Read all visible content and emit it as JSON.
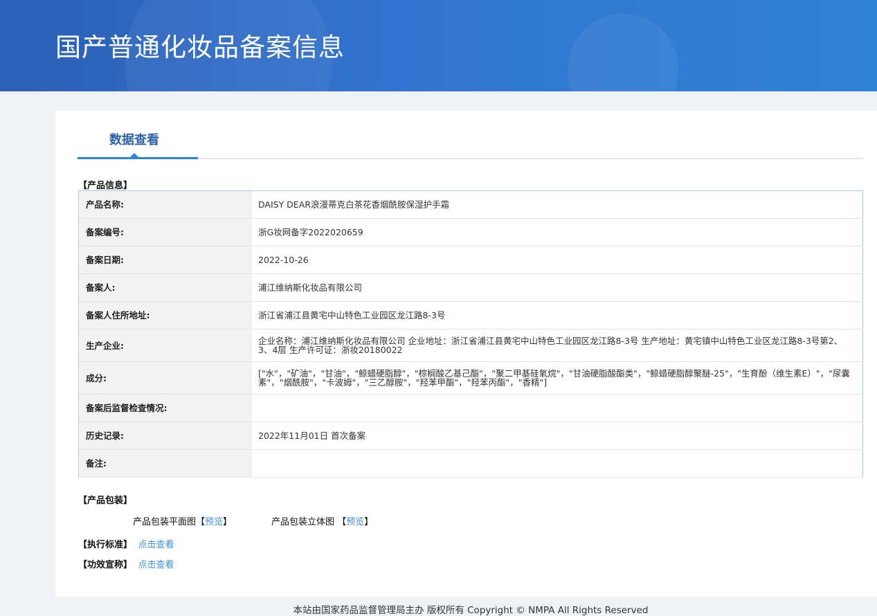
{
  "header": {
    "title": "国产普通化妆品备案信息"
  },
  "tab": {
    "label": "数据查看"
  },
  "product_info": {
    "section_title": "【产品信息】",
    "rows": [
      {
        "label": "产品名称:",
        "value": "DAISY DEAR浪漫蒂克白茶花香烟酰胺保湿护手霜"
      },
      {
        "label": "备案编号:",
        "value": "浙G妆网备字2022020659"
      },
      {
        "label": "备案日期:",
        "value": "2022-10-26"
      },
      {
        "label": "备案人:",
        "value": "浦江维纳斯化妆品有限公司"
      },
      {
        "label": "备案人住所地址:",
        "value": "浙江省浦江县黄宅中山特色工业园区龙江路8-3号"
      },
      {
        "label": "生产企业:",
        "value": "企业名称：浦江维纳斯化妆品有限公司 企业地址：浙江省浦江县黄宅中山特色工业园区龙江路8-3号 生产地址：黄宅镇中山特色工业区龙江路8-3号第2、3、4层 生产许可证：浙妆20180022"
      },
      {
        "label": "成分:",
        "value": "[\"水\"，\"矿油\"，\"甘油\"，\"鲸蜡硬脂醇\"，\"棕榈酸乙基己酯\"，\"聚二甲基硅氧烷\"，\"甘油硬脂酸酯类\"，\"鲸蜡硬脂醇聚醚-25\"，\"生育酚（维生素E）\"，\"尿囊素\"，\"烟酰胺\"，\"卡波姆\"，\"三乙醇胺\"，\"羟苯甲酯\"，\"羟苯丙酯\"，\"香精\"]"
      },
      {
        "label": "备案后监督检查情况:",
        "value": ""
      },
      {
        "label": "历史记录:",
        "value": "2022年11月01日 首次备案"
      },
      {
        "label": "备注:",
        "value": ""
      }
    ]
  },
  "packaging": {
    "section_title": "【产品包装】",
    "flat_label": "产品包装平面图",
    "solid_label": "产品包装立体图",
    "open": "【",
    "close": "】",
    "preview": "预览"
  },
  "standard": {
    "label": "【执行标准】",
    "link": "点击查看"
  },
  "efficacy": {
    "label": "【功效宣称】",
    "link": "点击查看"
  },
  "footer": {
    "text": "本站由国家药品监督管理局主办 版权所有 Copyright © NMPA All Rights Reserved"
  }
}
